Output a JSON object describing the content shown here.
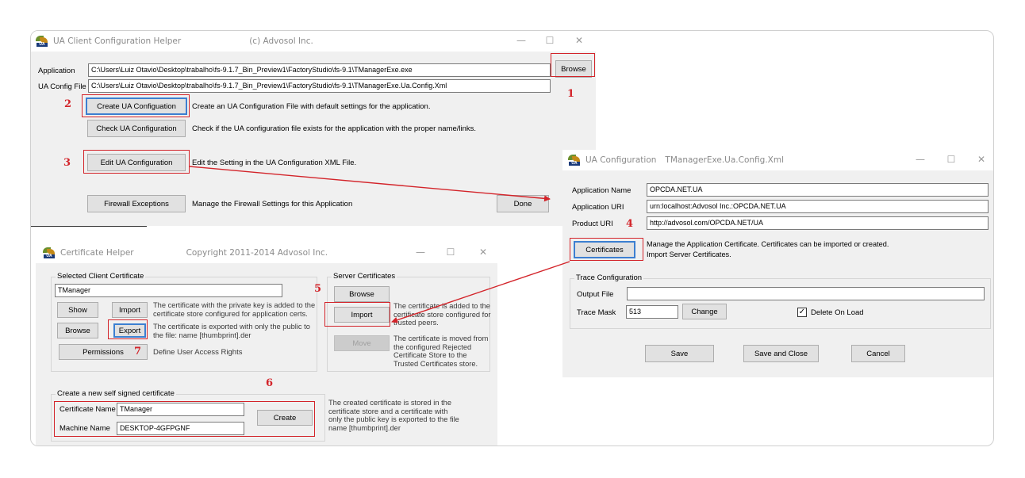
{
  "ua_helper": {
    "title": "UA Client Configuration Helper",
    "copyright": "(c) Advosol Inc.",
    "application_label": "Application",
    "application_value": "C:\\Users\\Luiz Otavio\\Desktop\\trabalho\\fs-9.1.7_Bin_Preview1\\FactoryStudio\\fs-9.1\\TManagerExe.exe",
    "config_label": "UA Config File",
    "config_value": "C:\\Users\\Luiz Otavio\\Desktop\\trabalho\\fs-9.1.7_Bin_Preview1\\FactoryStudio\\fs-9.1\\TManagerExe.Ua.Config.Xml",
    "browse_label": "Browse",
    "create_label": "Create UA Configuation",
    "create_desc": "Create an UA Configuration File with default settings for the application.",
    "check_label": "Check UA Configuration",
    "check_desc": "Check if the UA configuration file exists for the application with the proper name/links.",
    "edit_label": "Edit UA Configuration",
    "edit_desc": "Edit the Setting in the UA Configuration XML File.",
    "firewall_label": "Firewall Exceptions",
    "firewall_desc": "Manage the Firewall Settings for this Application",
    "done_label": "Done"
  },
  "ua_config": {
    "title": "UA Configuration",
    "file": "TManagerExe.Ua.Config.Xml",
    "app_name_label": "Application Name",
    "app_name_value": "OPCDA.NET.UA",
    "app_uri_label": "Application URI",
    "app_uri_value": "urn:localhost:Advosol Inc.:OPCDA.NET.UA",
    "product_uri_label": "Product URI",
    "product_uri_value": "http://advosol.com/OPCDA.NET/UA",
    "certificates_label": "Certificates",
    "certificates_desc_1": "Manage the Application Certificate.  Certificates can be imported or created.",
    "certificates_desc_2": "Import Server Certificates.",
    "trace_group": "Trace Configuration",
    "output_file_label": "Output File",
    "output_file_value": "",
    "trace_mask_label": "Trace Mask",
    "trace_mask_value": "513",
    "change_label": "Change",
    "delete_on_load_label": "Delete On Load",
    "delete_on_load_checked": true,
    "save_label": "Save",
    "save_close_label": "Save and Close",
    "cancel_label": "Cancel"
  },
  "cert_helper": {
    "title": "Certificate Helper",
    "copyright": "Copyright 2011-2014 Advosol Inc.",
    "selected_group": "Selected Client Certificate",
    "selected_value": "TManager",
    "show_label": "Show",
    "import_label": "Import",
    "import_desc": "The certificate with the private key is added to the certificate store configured for application certs.",
    "browse_label": "Browse",
    "export_label": "Export",
    "export_desc": "The certificate is exported with only the public to the file:   name [thumbprint].der",
    "permissions_label": "Permissions",
    "permissions_desc": "Define User Access Rights",
    "server_group": "Server Certificates",
    "server_browse_label": "Browse",
    "server_import_label": "Import",
    "server_import_desc": "The certificate is added to the certificate store configured for trusted peers.",
    "move_label": "Move",
    "move_desc": "The certificate is moved from the configured Rejected Certificate Store to the Trusted Certificates store.",
    "new_group": "Create a new self signed certificate",
    "cert_name_label": "Certificate Name",
    "cert_name_value": "TManager",
    "machine_name_label": "Machine Name",
    "machine_name_value": "DESKTOP-4GFPGNF",
    "create_label": "Create",
    "create_desc": "The created certificate is stored in the certificate store and a certificate with only the public key is exported to the file  name [thumbprint].der"
  },
  "window_controls": {
    "minimize": "—",
    "maximize": "☐",
    "close": "✕"
  },
  "app_icon_text": "UA",
  "annotations": {
    "n1": "1",
    "n2": "2",
    "n3": "3",
    "n4": "4",
    "n5": "5",
    "n6": "6",
    "n7": "7",
    "color": "#d3242a"
  }
}
